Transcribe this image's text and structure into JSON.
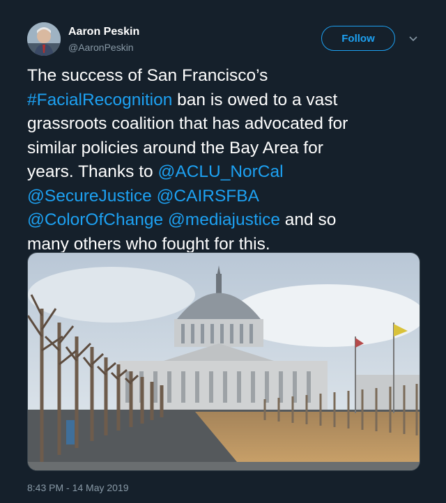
{
  "author": {
    "display_name": "Aaron Peskin",
    "handle": "@AaronPeskin"
  },
  "actions": {
    "follow_label": "Follow",
    "more_icon": "chevron-down-icon"
  },
  "tweet": {
    "text_parts": [
      {
        "text": "The success of San Francisco’s\n",
        "link": false
      },
      {
        "text": "#FacialRecognition",
        "link": true
      },
      {
        "text": " ban is owed to a vast\ngrassroots coalition that has advocated for\nsimilar policies around the Bay Area for\nyears. Thanks to ",
        "link": false
      },
      {
        "text": "@ACLU_NorCal",
        "link": true
      },
      {
        "text": "\n",
        "link": false
      },
      {
        "text": "@SecureJustice",
        "link": true
      },
      {
        "text": " ",
        "link": false
      },
      {
        "text": "@CAIRSFBA",
        "link": true
      },
      {
        "text": "\n",
        "link": false
      },
      {
        "text": "@ColorOfChange",
        "link": true
      },
      {
        "text": " ",
        "link": false
      },
      {
        "text": "@mediajustice",
        "link": true
      },
      {
        "text": " and so\nmany others who fought for this.",
        "link": false
      }
    ],
    "timestamp": "8:43 PM - 14 May 2019"
  },
  "colors": {
    "background": "#15202b",
    "link": "#1da1f2",
    "secondary_text": "#8899a6",
    "border": "#38444d"
  },
  "media": {
    "image_icon": "photo-city-hall"
  }
}
